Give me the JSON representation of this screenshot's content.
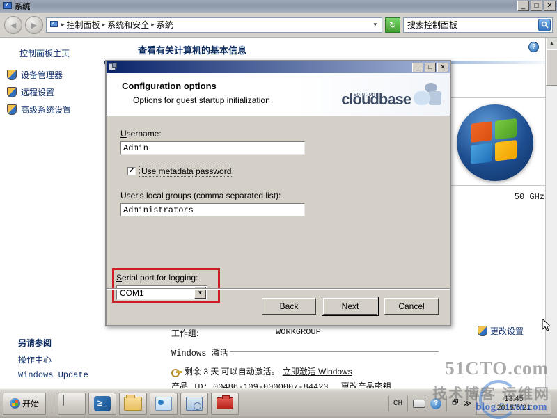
{
  "window": {
    "title": "系统",
    "title_icon": "monitor-icon",
    "controls": {
      "minimize": "_",
      "maximize": "□",
      "close": "✕"
    }
  },
  "addressbar": {
    "back_icon": "back-arrow-icon",
    "forward_icon": "forward-arrow-icon",
    "crumb_icon": "monitor-icon",
    "crumbs": [
      "控制面板",
      "系统和安全",
      "系统"
    ],
    "separator": "▸",
    "dropdown": "▾",
    "refresh_icon": "refresh-icon",
    "refresh_glyph": "↻",
    "search": {
      "placeholder": "搜索控制面板",
      "value": "",
      "icon": "search-icon",
      "icon_glyph": "🔍"
    }
  },
  "sidebar": {
    "home_label": "控制面板主页",
    "items": [
      {
        "label": "设备管理器",
        "icon": "shield-icon"
      },
      {
        "label": "远程设置",
        "icon": "shield-icon"
      },
      {
        "label": "高级系统设置",
        "icon": "shield-icon"
      }
    ],
    "see_also_title": "另请参阅",
    "see_also": [
      {
        "label": "操作中心"
      },
      {
        "label": "Windows Update"
      }
    ]
  },
  "main": {
    "page_title": "查看有关计算机的基本信息",
    "help_icon": "help-icon",
    "help_glyph": "?",
    "windows_logo": "windows-logo",
    "cpu_speed": "50 GHz",
    "change_settings": {
      "label": "更改设置",
      "icon": "shield-icon"
    },
    "workgroup_label": "工作组:",
    "workgroup_value": "WORKGROUP",
    "activation_section": "Windows 激活",
    "activation_icon": "key-icon",
    "activation_text": "剩余 3 天 可以自动激活。",
    "activate_link": "立即激活 Windows",
    "product_id_label": "产品 ID: 00486-109-0000007-84423",
    "change_key_link": "更改产品密钥",
    "scrollbar": {
      "up": "▲",
      "down": "▼"
    }
  },
  "dialog": {
    "titlebar_icon": "setup-icon",
    "controls": {
      "minimize": "_",
      "maximize": "□",
      "close": "✕"
    },
    "heading": "Configuration options",
    "subheading": "Options for guest startup initialization",
    "brand": {
      "name": "cloudbase",
      "tagline": "solutions",
      "logo": "cloudbase-logo"
    },
    "fields": {
      "username_label": "Username:",
      "username_value": "Admin",
      "metadata_checkbox_label": "Use metadata password",
      "metadata_checkbox_checked": "✔",
      "groups_label": "User's local groups (comma separated list):",
      "groups_value": "Administrators",
      "serial_label": "Serial port for logging:",
      "serial_value": "COM1",
      "serial_arrow": "▼"
    },
    "highlight_color": "#cc1f1f",
    "buttons": {
      "back": "Back",
      "next": "Next",
      "cancel": "Cancel"
    }
  },
  "taskbar": {
    "start_label": "开始",
    "start_icon": "windows-orb-icon",
    "quicklaunch": [
      {
        "name": "server-manager-icon"
      },
      {
        "name": "powershell-icon",
        "glyph": "≥_"
      },
      {
        "name": "explorer-folder-icon"
      },
      {
        "name": "control-panel-icon"
      },
      {
        "name": "computer-monitor-icon"
      },
      {
        "name": "toolbox-icon"
      }
    ],
    "tray": {
      "ime": "CH",
      "keyboard_icon": "keyboard-icon",
      "help_icon": "help-icon",
      "help_glyph": "?",
      "show_desktop_icon": "restore-icon",
      "expand_icon": "chevron-up-icon",
      "expand_glyph": "≫",
      "clock_time": "13:45",
      "clock_date": "2015/6/21"
    }
  },
  "watermark": {
    "line1": "51CTO.com",
    "line2": "技术博客 运维网",
    "line3": "blog.51cto.com"
  }
}
